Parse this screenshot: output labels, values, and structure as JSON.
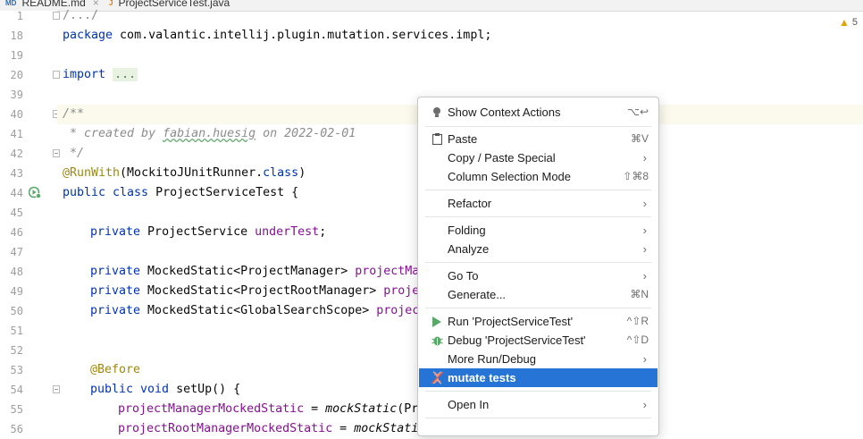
{
  "tabs": [
    {
      "icon_text": "MD",
      "label": "README.md",
      "active": false
    },
    {
      "icon_text": "J",
      "label": "ProjectServiceTest.java",
      "active": true
    }
  ],
  "inspection": {
    "count": "5",
    "icon": "warning-triangle-icon"
  },
  "gutter": {
    "line_numbers": [
      "1",
      "18",
      "19",
      "20",
      "39",
      "40",
      "41",
      "42",
      "43",
      "44",
      "45",
      "46",
      "47",
      "48",
      "49",
      "50",
      "51",
      "52",
      "53",
      "54",
      "55",
      "56"
    ]
  },
  "code": {
    "l1": "/.../",
    "l18_kw": "package",
    "l18_rest": " com.valantic.intellij.plugin.mutation.services.impl;",
    "l20_kw": "import",
    "l20_fold": "...",
    "l40": "/**",
    "l41_a": " * created by ",
    "l41_b": "fabian.huesig",
    "l41_c": " on 2022-02-01",
    "l42": " */",
    "l43_an": "@RunWith",
    "l43_a": "(MockitoJUnitRunner.",
    "l43_kw": "class",
    "l43_b": ")",
    "l44_kw": "public class",
    "l44_rest": " ProjectServiceTest {",
    "l46_kw": "private",
    "l46_a": " ProjectService ",
    "l46_fld": "underTest",
    "l46_b": ";",
    "l48_kw": "private",
    "l48_a": " MockedStatic<ProjectManager> ",
    "l48_fld": "projectMan",
    "l49_kw": "private",
    "l49_a": " MockedStatic<ProjectRootManager> ",
    "l49_fld": "projec",
    "l50_kw": "private",
    "l50_a": " MockedStatic<GlobalSearchScope> ",
    "l50_fld": "project",
    "l53_an": "@Before",
    "l54_kw": "public void",
    "l54_a": " setUp() {",
    "l55_fld": "projectManagerMockedStatic",
    "l55_a": " = ",
    "l55_it": "mockStatic",
    "l55_b": "(Pro",
    "l56_fld": "projectRootManagerMockedStatic",
    "l56_a": " = ",
    "l56_it": "mockStatic"
  },
  "menu": {
    "show_context_actions": {
      "label": "Show Context Actions",
      "shortcut": "⌥↩"
    },
    "paste": {
      "label": "Paste",
      "shortcut": "⌘V"
    },
    "copy_paste_special": {
      "label": "Copy / Paste Special"
    },
    "column_selection_mode": {
      "label": "Column Selection Mode",
      "shortcut": "⇧⌘8"
    },
    "refactor": {
      "label": "Refactor"
    },
    "folding": {
      "label": "Folding"
    },
    "analyze": {
      "label": "Analyze"
    },
    "go_to": {
      "label": "Go To"
    },
    "generate": {
      "label": "Generate...",
      "shortcut": "⌘N"
    },
    "run": {
      "label": "Run 'ProjectServiceTest'",
      "shortcut": "^⇧R"
    },
    "debug": {
      "label": "Debug 'ProjectServiceTest'",
      "shortcut": "^⇧D"
    },
    "more_run_debug": {
      "label": "More Run/Debug"
    },
    "mutate_tests": {
      "label": "mutate tests"
    },
    "open_in": {
      "label": "Open In"
    },
    "submenu_arrow": "›"
  },
  "colors": {
    "selection": "#2675d6",
    "run_green": "#59a869",
    "keyword": "#0033b3",
    "annotation": "#9e880d",
    "field": "#871094"
  }
}
